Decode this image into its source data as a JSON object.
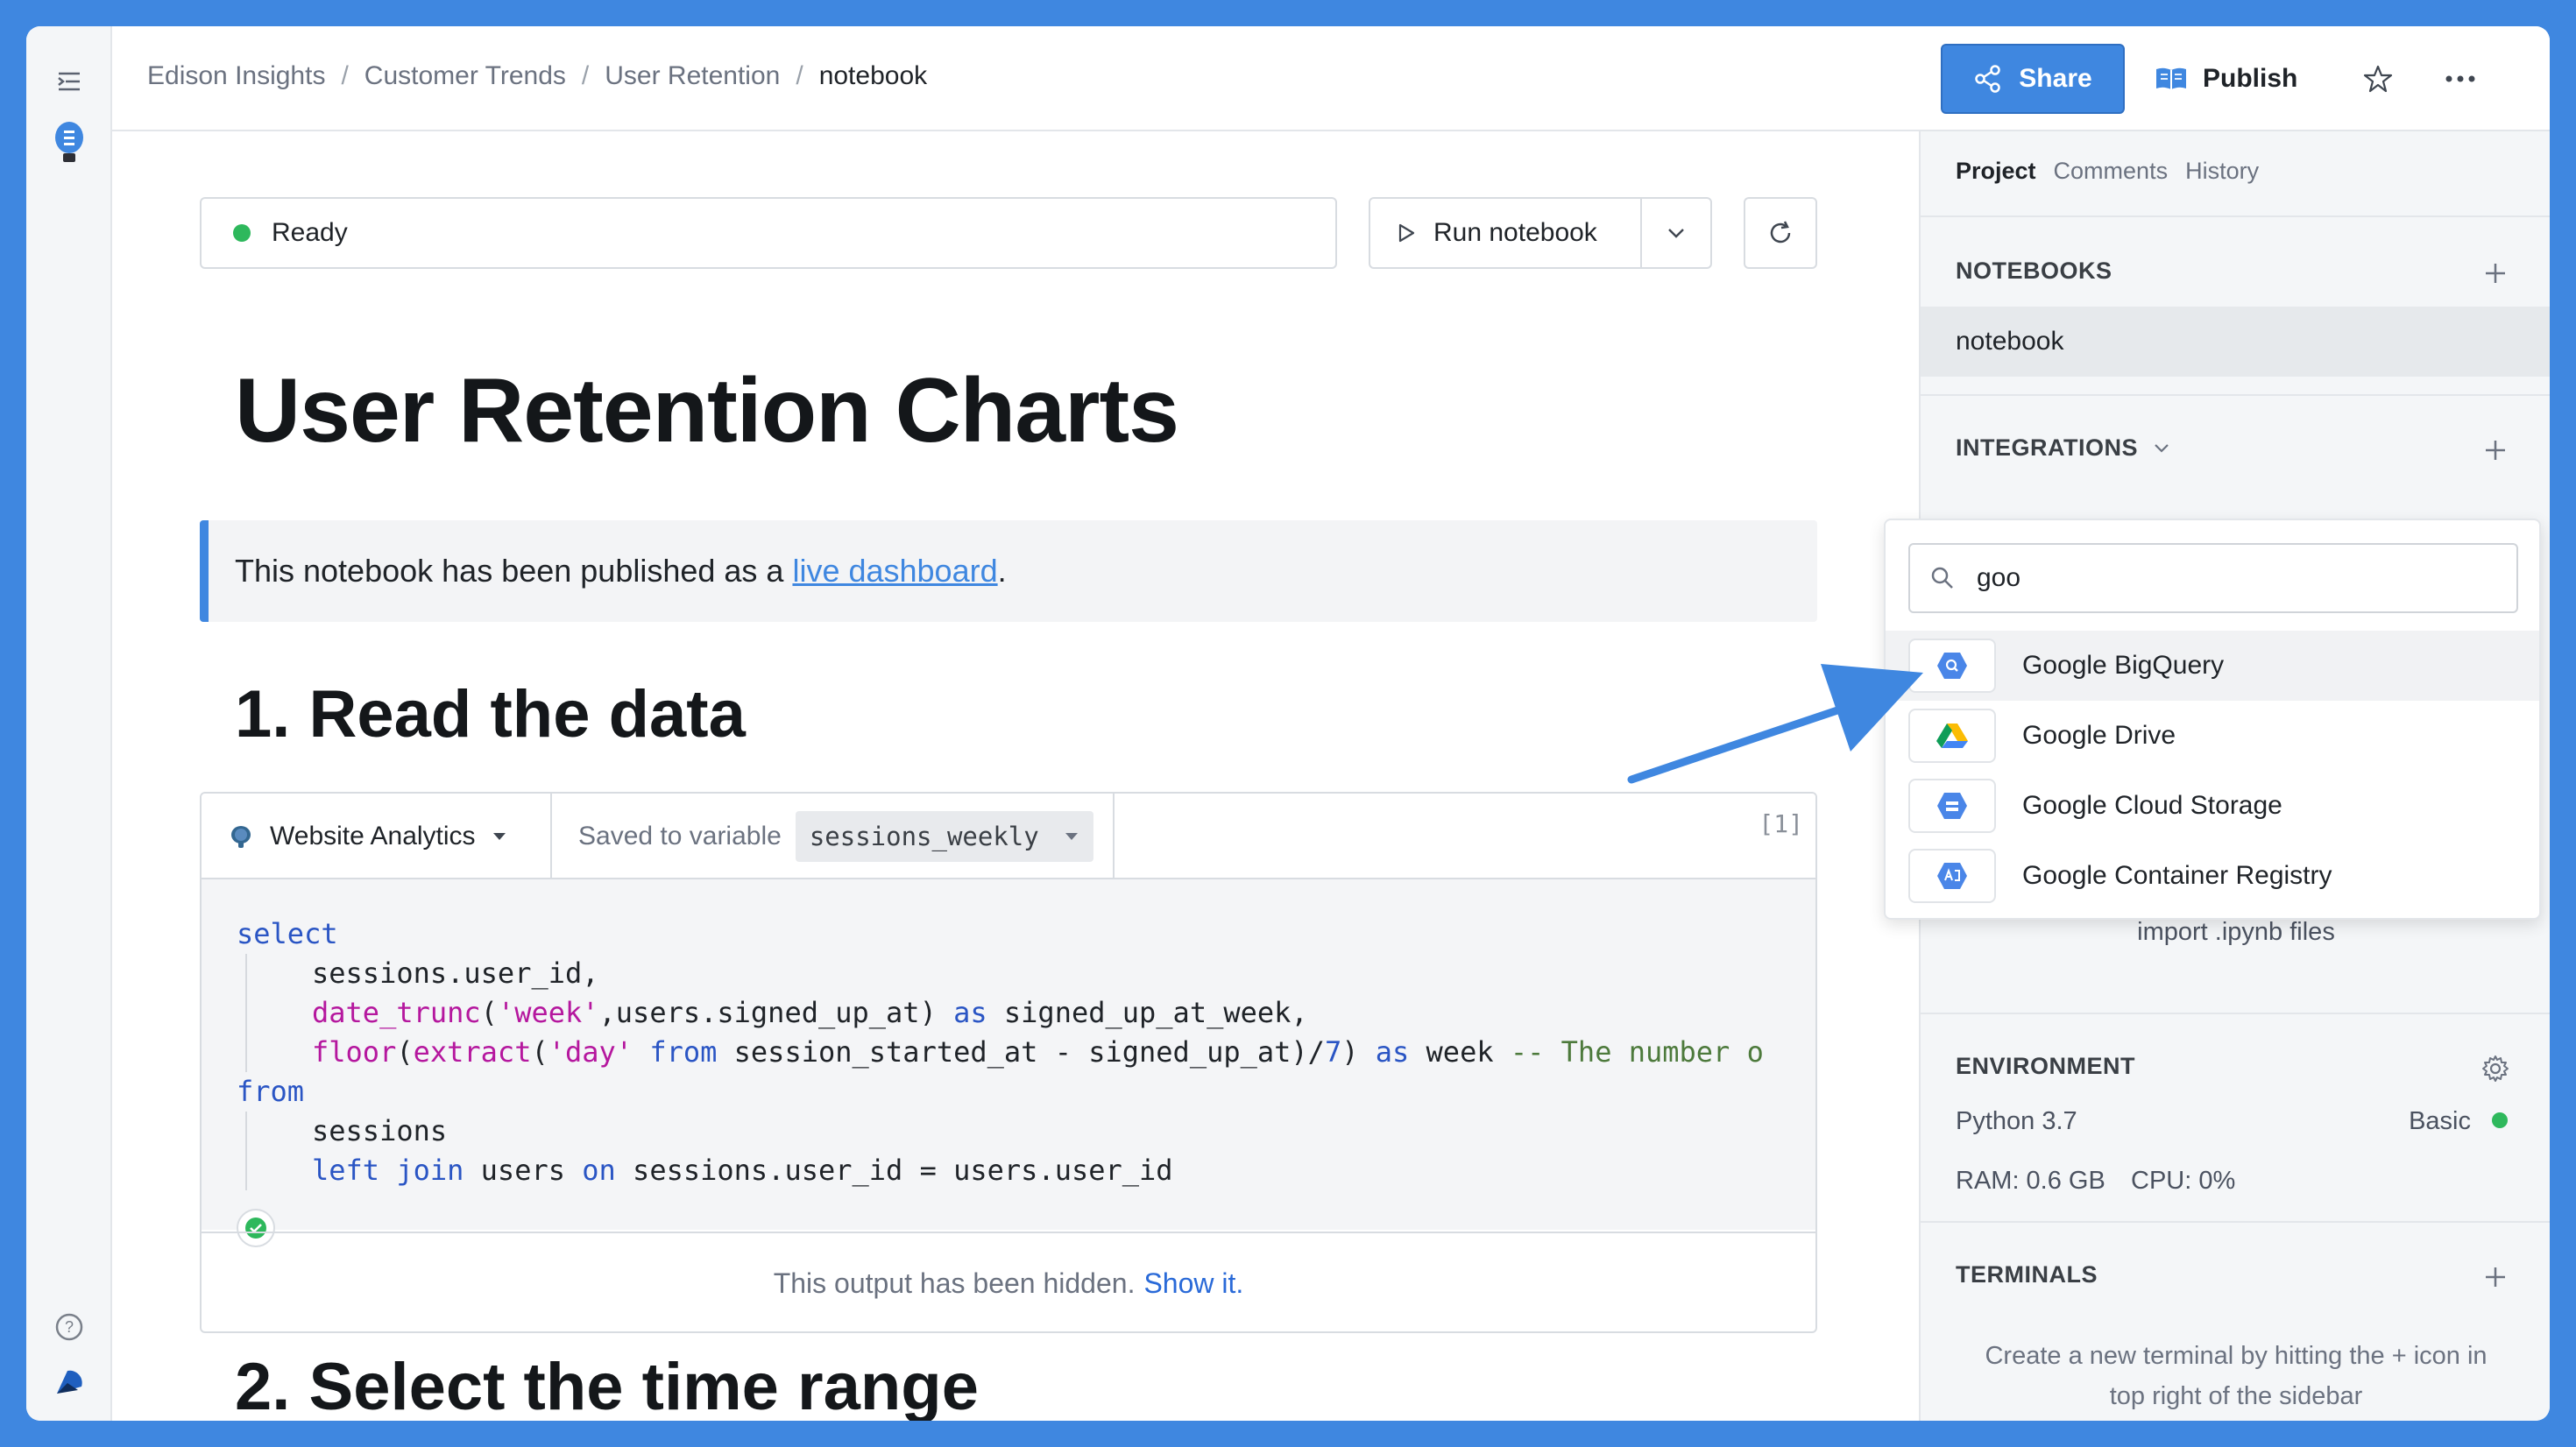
{
  "breadcrumb": [
    "Edison Insights",
    "Customer Trends",
    "User Retention",
    "notebook"
  ],
  "header": {
    "share_label": "Share",
    "publish_label": "Publish"
  },
  "status": {
    "text": "Ready"
  },
  "run": {
    "label": "Run notebook"
  },
  "notebook": {
    "title": "User Retention Charts",
    "callout_prefix": "This notebook has been published as a",
    "callout_link": "live dashboard",
    "callout_suffix": ".",
    "section1": "1. Read the data",
    "section2": "2. Select the time range"
  },
  "cell": {
    "source": "Website Analytics",
    "saved_label": "Saved to variable",
    "variable": "sessions_weekly",
    "exec_count": "[1]",
    "code_lines": [
      "select",
      "sessions.user_id,",
      "date_trunc('week',users.signed_up_at) as signed_up_at_week,",
      "floor(extract('day' from session_started_at - signed_up_at)/7) as week -- The number o",
      "from",
      "sessions",
      "left join users on sessions.user_id = users.user_id"
    ],
    "hidden_text": "This output has been hidden.",
    "show_label": "Show it."
  },
  "sidebar": {
    "tabs": [
      "Project",
      "Comments",
      "History"
    ],
    "notebooks_label": "NOTEBOOKS",
    "notebook_item": "notebook",
    "integrations_label": "INTEGRATIONS",
    "import_text": "import .ipynb files",
    "environment_label": "ENVIRONMENT",
    "python": "Python 3.7",
    "tier": "Basic",
    "ram": "RAM: 0.6 GB",
    "cpu": "CPU: 0%",
    "terminals_label": "TERMINALS",
    "terminals_hint_1": "Create a new terminal by hitting the + icon in",
    "terminals_hint_2": "top right of the sidebar"
  },
  "integration_search": {
    "query": "goo",
    "options": [
      "Google BigQuery",
      "Google Drive",
      "Google Cloud Storage",
      "Google Container Registry"
    ]
  },
  "colors": {
    "accent": "#3f87e0",
    "status_ok": "#2eb85c"
  }
}
